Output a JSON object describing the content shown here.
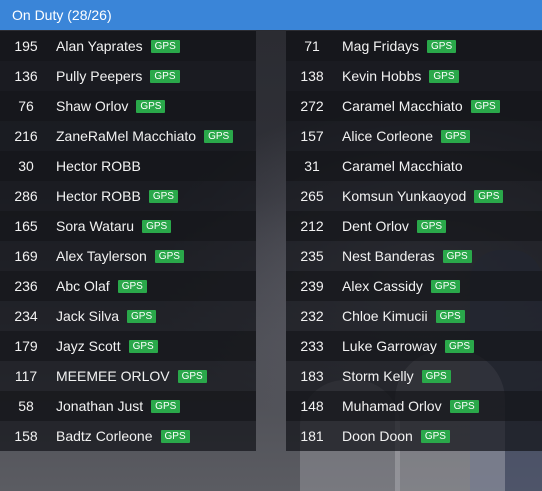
{
  "header": {
    "title": "On Duty (28/26)"
  },
  "gps_label": "GPS",
  "left": [
    {
      "id": "195",
      "name": "Alan Yaprates",
      "gps": true
    },
    {
      "id": "136",
      "name": "Pully Peepers",
      "gps": true
    },
    {
      "id": "76",
      "name": "Shaw Orlov",
      "gps": true
    },
    {
      "id": "216",
      "name": "ZaneRaMel Macchiato",
      "gps": true
    },
    {
      "id": "30",
      "name": "Hector ROBB",
      "gps": false
    },
    {
      "id": "286",
      "name": "Hector ROBB",
      "gps": true
    },
    {
      "id": "165",
      "name": "Sora Wataru",
      "gps": true
    },
    {
      "id": "169",
      "name": "Alex Taylerson",
      "gps": true
    },
    {
      "id": "236",
      "name": "Abc Olaf",
      "gps": true
    },
    {
      "id": "234",
      "name": "Jack Silva",
      "gps": true
    },
    {
      "id": "179",
      "name": "Jayz Scott",
      "gps": true
    },
    {
      "id": "117",
      "name": "MEEMEE ORLOV",
      "gps": true
    },
    {
      "id": "58",
      "name": "Jonathan Just",
      "gps": true
    },
    {
      "id": "158",
      "name": "Badtz Corleone",
      "gps": true
    }
  ],
  "right": [
    {
      "id": "71",
      "name": "Mag Fridays",
      "gps": true
    },
    {
      "id": "138",
      "name": "Kevin Hobbs",
      "gps": true
    },
    {
      "id": "272",
      "name": "Caramel Macchiato",
      "gps": true
    },
    {
      "id": "157",
      "name": "Alice Corleone",
      "gps": true
    },
    {
      "id": "31",
      "name": "Caramel Macchiato",
      "gps": false
    },
    {
      "id": "265",
      "name": "Komsun Yunkaoyod",
      "gps": true
    },
    {
      "id": "212",
      "name": "Dent Orlov",
      "gps": true
    },
    {
      "id": "235",
      "name": "Nest Banderas",
      "gps": true
    },
    {
      "id": "239",
      "name": "Alex Cassidy",
      "gps": true
    },
    {
      "id": "232",
      "name": "Chloe Kimucii",
      "gps": true
    },
    {
      "id": "233",
      "name": "Luke Garroway",
      "gps": true
    },
    {
      "id": "183",
      "name": "Storm Kelly",
      "gps": true
    },
    {
      "id": "148",
      "name": "Muhamad Orlov",
      "gps": true
    },
    {
      "id": "181",
      "name": "Doon Doon",
      "gps": true
    }
  ]
}
